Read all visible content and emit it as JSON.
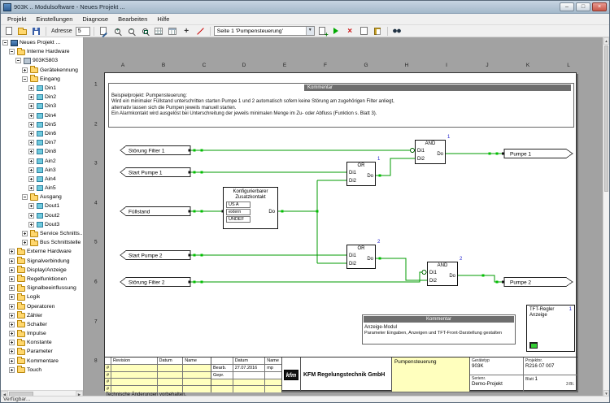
{
  "titlebar": {
    "title": "903K .. Modulsoftware  -  Neues Projekt ..."
  },
  "menubar": {
    "items": [
      "Projekt",
      "Einstellungen",
      "Diagnose",
      "Bearbeiten",
      "Hilfe"
    ]
  },
  "toolbar": {
    "address_label": "Adresse",
    "address_value": "5",
    "page_select": "Seite 1 'Pumpensteuerung'"
  },
  "tree": {
    "items": [
      {
        "label": "Neues Projekt ...",
        "icon": "project-icon"
      },
      {
        "label": "Interne Hardware",
        "icon": "folder-icon"
      },
      {
        "label": "903K5803",
        "icon": "device-icon"
      },
      {
        "label": "Gerätekennung",
        "icon": "folder-icon"
      },
      {
        "label": "Eingang",
        "icon": "folder-icon"
      },
      {
        "label": "Din1",
        "icon": "input-channel-icon"
      },
      {
        "label": "Din2",
        "icon": "input-channel-icon"
      },
      {
        "label": "Din3",
        "icon": "input-channel-icon"
      },
      {
        "label": "Din4",
        "icon": "input-channel-icon"
      },
      {
        "label": "Din5",
        "icon": "input-channel-icon"
      },
      {
        "label": "Din6",
        "icon": "input-channel-icon"
      },
      {
        "label": "Din7",
        "icon": "input-channel-icon"
      },
      {
        "label": "Din8",
        "icon": "input-channel-icon"
      },
      {
        "label": "Ain2",
        "icon": "input-channel-icon"
      },
      {
        "label": "Ain3",
        "icon": "input-channel-icon"
      },
      {
        "label": "Ain4",
        "icon": "input-channel-icon"
      },
      {
        "label": "Ain5",
        "icon": "input-channel-icon"
      },
      {
        "label": "Ausgang",
        "icon": "folder-icon"
      },
      {
        "label": "Dout1",
        "icon": "output-channel-icon"
      },
      {
        "label": "Dout2",
        "icon": "output-channel-icon"
      },
      {
        "label": "Dout3",
        "icon": "output-channel-icon"
      },
      {
        "label": "Service Schnitts...",
        "icon": "folder-icon"
      },
      {
        "label": "Bus Schnittstelle",
        "icon": "folder-icon"
      },
      {
        "label": "Externe Hardware",
        "icon": "folder-icon"
      },
      {
        "label": "Signalverbindung",
        "icon": "folder-icon"
      },
      {
        "label": "Display/Anzeige",
        "icon": "folder-icon"
      },
      {
        "label": "Regelfunktionen",
        "icon": "folder-icon"
      },
      {
        "label": "Signalbeeinflussung",
        "icon": "folder-icon"
      },
      {
        "label": "Logik",
        "icon": "folder-icon"
      },
      {
        "label": "Operatoren",
        "icon": "folder-icon"
      },
      {
        "label": "Zähler",
        "icon": "folder-icon"
      },
      {
        "label": "Schalter",
        "icon": "folder-icon"
      },
      {
        "label": "Impulse",
        "icon": "folder-icon"
      },
      {
        "label": "Konstante",
        "icon": "folder-icon"
      },
      {
        "label": "Parameter",
        "icon": "folder-icon"
      },
      {
        "label": "Kommentare",
        "icon": "folder-icon"
      },
      {
        "label": "Touch",
        "icon": "folder-icon"
      }
    ]
  },
  "canvas": {
    "columns": [
      "A",
      "B",
      "C",
      "D",
      "E",
      "F",
      "G",
      "H",
      "I",
      "J",
      "K",
      "L"
    ],
    "rows": [
      "1",
      "2",
      "3",
      "4",
      "5",
      "6",
      "7",
      "8"
    ],
    "footer_note": "Technische Änderungen vorbehalten."
  },
  "diagram": {
    "comment_top": {
      "header": "Kommentar",
      "lines": [
        "Beispielprojekt: Pumpensteuerung:",
        "Wird ein minimaler Füllstand unterschritten starten Pumpe 1 und 2 automatisch sofern keine Störung am zugehörigen Filter anliegt,",
        "alternativ lassen sich die Pumpen jeweils manuell starten.",
        "Ein Alarmkontakt wird ausgelöst bei Unterschreitung der jeweils minimalen Menge im Zu- oder Abfluss (Funktion s. Blatt 3)."
      ]
    },
    "comment_bottom": {
      "header": "Kommentar",
      "lines": [
        "Anzeige-Modul",
        "Parameter Eingaben, Anzeigen und TFT-Front-Darstellung gestalten"
      ]
    },
    "inputs": [
      "Störung Filter 1",
      "Start Pumpe 1",
      "Füllstand",
      "Start Pumpe 2",
      "Störung Filter 2"
    ],
    "outputs": [
      "Pumpe 1",
      "Pumpe 2"
    ],
    "gates": {
      "or1": {
        "title": "OR",
        "in1": "Di1",
        "in2": "Di2",
        "out": "Do",
        "num": "1"
      },
      "or2": {
        "title": "OR",
        "in1": "Di1",
        "in2": "Di2",
        "out": "Do",
        "num": "2"
      },
      "and1": {
        "title": "AND",
        "in1": "Di1",
        "in2": "Di2",
        "out": "Do",
        "num": "1"
      },
      "and2": {
        "title": "AND",
        "in1": "Di1",
        "in2": "Di2",
        "out": "Do",
        "num": "2"
      }
    },
    "kontakt": {
      "title_line1": "Konfigurierbarer",
      "title_line2": "Zusatzkontakt",
      "field1": "US A",
      "field2": "extern",
      "field3": "UNDEF",
      "out": "Do"
    },
    "tft": {
      "line1": "TFT-Regler",
      "line2": "Anzeige",
      "num": "1"
    }
  },
  "titleblock": {
    "hash": "#",
    "col_revision": "Revision",
    "col_datum": "Datum",
    "col_name": "Name",
    "bearb_label": "Bearb.",
    "bearb_datum": "27.07.2016",
    "bearb_name": "mp",
    "gepr_label": "Gepr.",
    "logo_text": "kfm",
    "company": "KFM Regelungstechnik GmbH",
    "project_title": "Pumpensteuerung",
    "geraetetyp_label": "Gerätetyp",
    "geraetetyp_value": "903K",
    "projektnr_label": "Projektnr.",
    "projektnr_value": "R216 07 007",
    "serienr_label": "Serienr.",
    "serienr_value": "Demo-Projekt",
    "blatt_label": "Blatt",
    "blatt_value": "1",
    "blatt_total": "3  Bl."
  },
  "statusbar": {
    "text": "Verfügbar..."
  },
  "colors": {
    "wire_green": "#009b00",
    "junction_green": "#00c000",
    "number_blue": "#2323cc",
    "comment_header_gray": "#6e6e6e",
    "titleblock_yellow": "#ffffbe",
    "titlebar_blue": "#aec4d8"
  }
}
